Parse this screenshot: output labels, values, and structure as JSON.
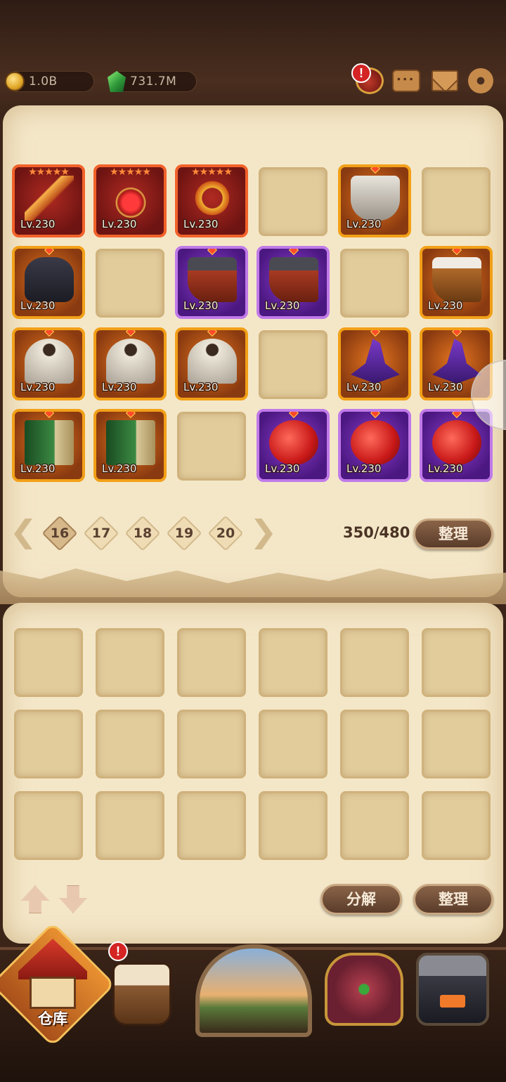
{
  "currency": {
    "gold": "1.0B",
    "gems": "731.7M"
  },
  "top_icons": [
    "potion-icon",
    "chat-icon",
    "mail-icon",
    "gear-icon"
  ],
  "alert": "!",
  "inventory_top": {
    "rows": [
      [
        {
          "type": "weapon",
          "rarity": "legend",
          "level": "Lv.230"
        },
        {
          "type": "amulet",
          "rarity": "legend",
          "level": "Lv.230"
        },
        {
          "type": "ring",
          "rarity": "legend",
          "level": "Lv.230"
        },
        null,
        {
          "type": "cloth",
          "rarity": "orange",
          "level": "Lv.230"
        },
        null
      ],
      [
        {
          "type": "glove",
          "rarity": "orange",
          "level": "Lv.230"
        },
        null,
        {
          "type": "boot",
          "rarity": "purple",
          "level": "Lv.230"
        },
        {
          "type": "boot",
          "rarity": "purple",
          "level": "Lv.230"
        },
        null,
        {
          "type": "boot2",
          "rarity": "orange",
          "level": "Lv.230"
        }
      ],
      [
        {
          "type": "helm",
          "rarity": "orange",
          "level": "Lv.230"
        },
        {
          "type": "helm",
          "rarity": "orange",
          "level": "Lv.230"
        },
        {
          "type": "helm",
          "rarity": "orange",
          "level": "Lv.230"
        },
        null,
        {
          "type": "hat",
          "rarity": "orange",
          "level": "Lv.230"
        },
        {
          "type": "hat",
          "rarity": "orange",
          "level": "Lv.230"
        }
      ],
      [
        {
          "type": "book",
          "rarity": "orange",
          "level": "Lv.230"
        },
        {
          "type": "book",
          "rarity": "orange",
          "level": "Lv.230"
        },
        null,
        {
          "type": "flask",
          "rarity": "purple",
          "level": "Lv.230"
        },
        {
          "type": "flask",
          "rarity": "purple",
          "level": "Lv.230"
        },
        {
          "type": "flask",
          "rarity": "purple",
          "level": "Lv.230"
        }
      ]
    ]
  },
  "pagination": {
    "pages": [
      "16",
      "17",
      "18",
      "19",
      "20"
    ],
    "active": "16",
    "capacity": "350/480",
    "sort_label": "整理"
  },
  "inventory_bottom": {
    "rows": 3,
    "cols": 6
  },
  "bottom_actions": {
    "decompose_label": "分解",
    "sort_label": "整理"
  },
  "nav": {
    "warehouse_label": "仓库"
  },
  "colors": {
    "panel": "#f4e7c8",
    "legend_border": "#f2622a",
    "epic_border": "#c07ae8",
    "orange_border": "#f2a018"
  }
}
